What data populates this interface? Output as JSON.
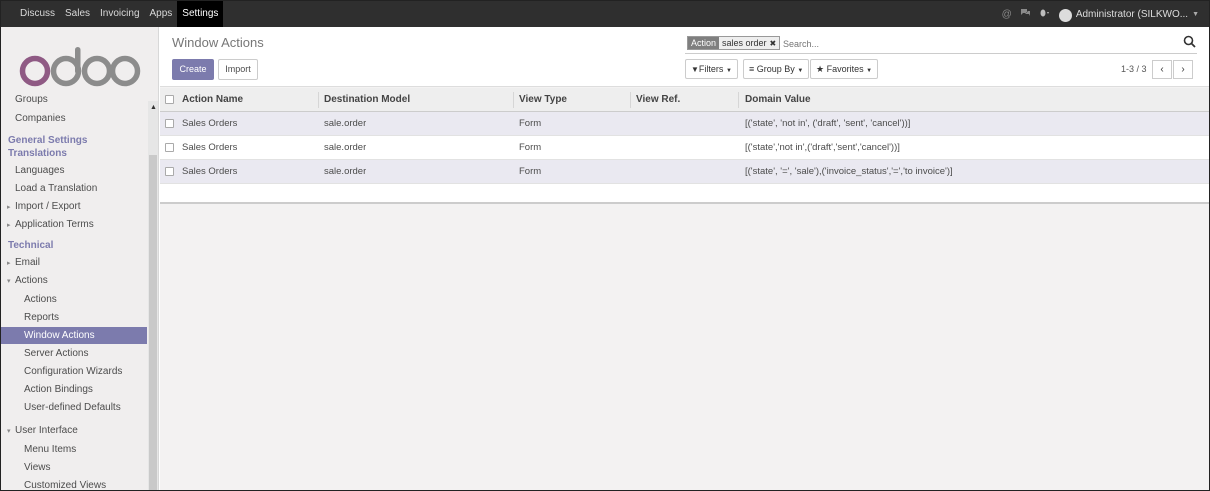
{
  "topnav": {
    "apps": [
      "Discuss",
      "Sales",
      "Invoicing",
      "Apps",
      "Settings"
    ],
    "active_app": "Settings",
    "user": "Administrator (SILKWO..."
  },
  "sidebar": {
    "logo": "odoo",
    "items": [
      {
        "label": "Groups",
        "type": "item"
      },
      {
        "label": "Companies",
        "type": "item"
      },
      {
        "label": "General Settings",
        "type": "header"
      },
      {
        "label": "Translations",
        "type": "header"
      },
      {
        "label": "Languages",
        "type": "item"
      },
      {
        "label": "Load a Translation",
        "type": "item"
      },
      {
        "label": "Import / Export",
        "type": "collapsed"
      },
      {
        "label": "Application Terms",
        "type": "collapsed"
      },
      {
        "label": "Technical",
        "type": "header"
      },
      {
        "label": "Email",
        "type": "collapsed"
      },
      {
        "label": "Actions",
        "type": "expanded"
      },
      {
        "label": "Actions",
        "type": "sub"
      },
      {
        "label": "Reports",
        "type": "sub"
      },
      {
        "label": "Window Actions",
        "type": "sub-active"
      },
      {
        "label": "Server Actions",
        "type": "sub"
      },
      {
        "label": "Configuration Wizards",
        "type": "sub"
      },
      {
        "label": "Action Bindings",
        "type": "sub"
      },
      {
        "label": "User-defined Defaults",
        "type": "sub"
      },
      {
        "label": "User Interface",
        "type": "expanded"
      },
      {
        "label": "Menu Items",
        "type": "sub"
      },
      {
        "label": "Views",
        "type": "sub"
      },
      {
        "label": "Customized Views",
        "type": "sub"
      }
    ]
  },
  "control_panel": {
    "title": "Window Actions",
    "create_label": "Create",
    "import_label": "Import",
    "search": {
      "facet_category": "Action",
      "facet_value": "sales order",
      "placeholder": "Search..."
    },
    "filters_label": "Filters",
    "groupby_label": "Group By",
    "favorites_label": "Favorites",
    "pager": "1-3 / 3"
  },
  "table": {
    "columns": [
      "Action Name",
      "Destination Model",
      "View Type",
      "View Ref.",
      "Domain Value"
    ],
    "rows": [
      [
        "Sales Orders",
        "sale.order",
        "Form",
        "",
        "[('state', 'not in', ('draft', 'sent', 'cancel'))]"
      ],
      [
        "Sales Orders",
        "sale.order",
        "Form",
        "",
        "[('state','not in',('draft','sent','cancel'))]"
      ],
      [
        "Sales Orders",
        "sale.order",
        "Form",
        "",
        "[('state', '=', 'sale'),('invoice_status','=','to invoice')]"
      ]
    ]
  },
  "colors": {
    "brand": "#7c7bad",
    "navbar": "#2f2f2f",
    "row_highlight": "#eae9f1"
  }
}
